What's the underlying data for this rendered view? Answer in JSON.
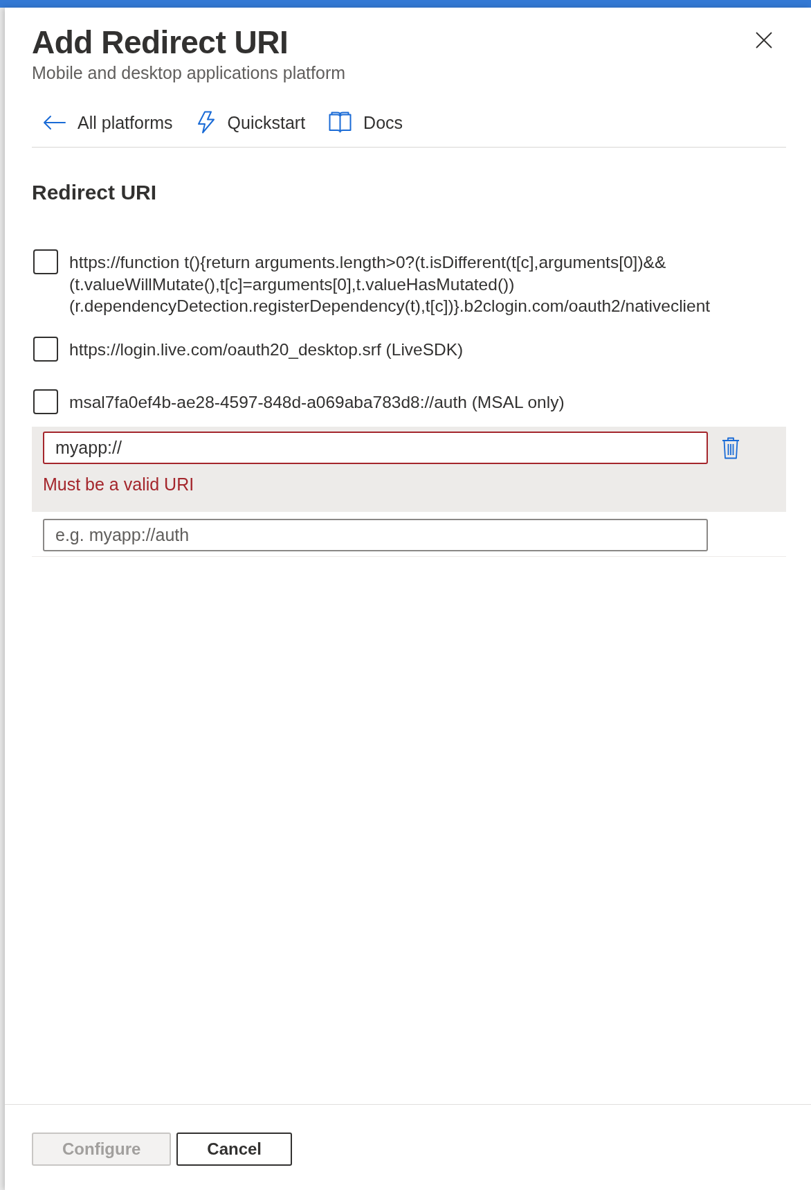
{
  "header": {
    "title": "Add Redirect URI",
    "subtitle": "Mobile and desktop applications platform"
  },
  "toolbar": [
    {
      "kind": "back",
      "label": "All platforms"
    },
    {
      "kind": "quickstart",
      "label": "Quickstart"
    },
    {
      "kind": "docs",
      "label": "Docs"
    }
  ],
  "redirect_uris": {
    "heading": "Redirect URI",
    "options": [
      {
        "uri": "https://function t(){return arguments.length>0?(t.isDifferent(t[c],arguments[0])&&(t.valueWillMutate(),t[c]=arguments[0],t.valueHasMutated())(r.dependencyDetection.registerDependency(t),t[c])}.b2clogin.com/oauth2/nativeclient",
        "checked": false
      },
      {
        "uri": "https://login.live.com/oauth20_desktop.srf (LiveSDK)",
        "checked": false
      },
      {
        "uri": "msal7fa0ef4b-ae28-4597-848d-a069aba783d8://auth (MSAL only)",
        "checked": false
      }
    ]
  },
  "custom_uris": [
    {
      "value": "myapp://",
      "invalid": true,
      "error": "Must be a valid URI",
      "deletable": true
    },
    {
      "placeholder": "e.g. myapp://auth",
      "invalid": false,
      "deletable": false
    }
  ],
  "footer": {
    "buttons": [
      {
        "kind": "primary",
        "label": "Configure",
        "disabled": true
      },
      {
        "kind": "default",
        "label": "Cancel",
        "disabled": false
      }
    ]
  }
}
